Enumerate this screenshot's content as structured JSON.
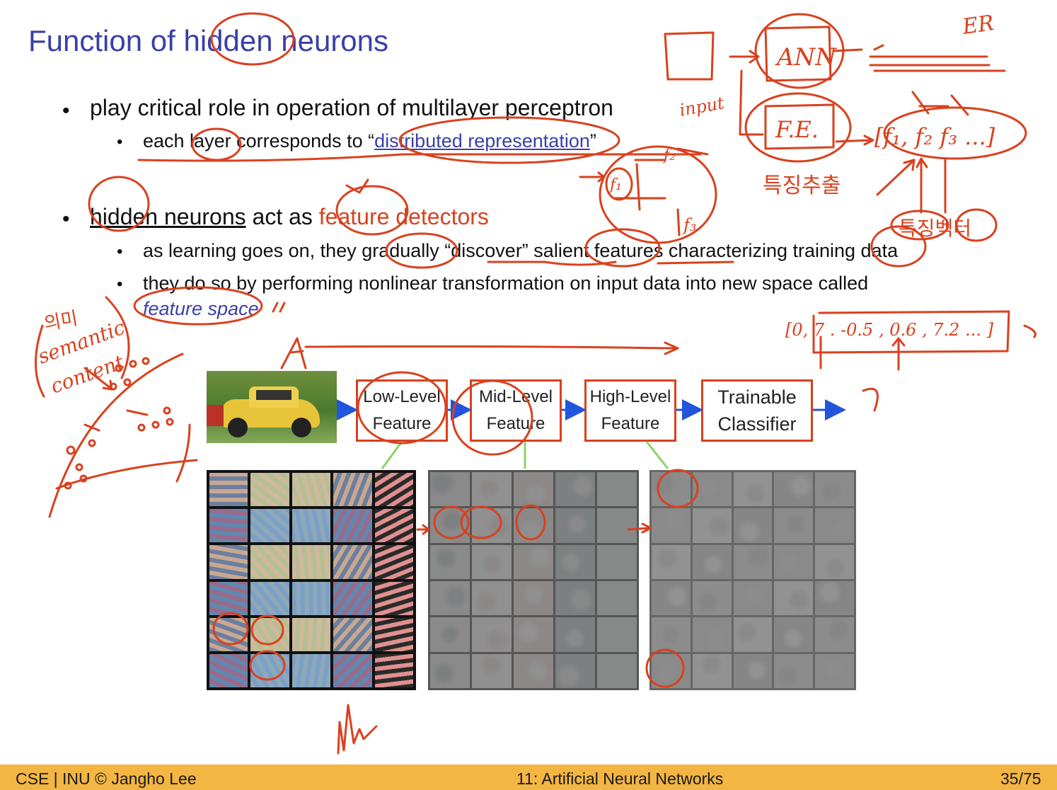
{
  "slide": {
    "title": "Function of hidden neurons",
    "bullet1": "play critical role in operation of multilayer perceptron",
    "bullet1_sub": {
      "prefix": "each layer corresponds to “",
      "highlight": "distributed representation",
      "suffix": "”"
    },
    "bullet2": {
      "underlined": "hidden neurons",
      "middle": " act as ",
      "highlight": "feature detectors"
    },
    "bullet2_sub1": "as learning goes on, they gradually “discover” salient features characterizing training data",
    "bullet2_sub2_line1": "they do so by performing nonlinear transformation on input data into new space called",
    "bullet2_sub2_line2": "feature space"
  },
  "pipeline": {
    "stages": [
      {
        "line1": "Low-Level",
        "line2": "Feature"
      },
      {
        "line1": "Mid-Level",
        "line2": "Feature"
      },
      {
        "line1": "High-Level",
        "line2": "Feature"
      },
      {
        "line1": "Trainable",
        "line2": "Classifier"
      }
    ]
  },
  "annotations": {
    "ann": "ANN",
    "fe": "F.E.",
    "input": "input",
    "er": "ER",
    "features": "[f₁, f₂ f₃ ...]",
    "korean1": "특징추출",
    "korean2": "특징벡터",
    "f1": "f₁",
    "f2": "f₂",
    "f3": "f₃",
    "vector": "[0, 7 . -0.5 , 0.6 , 7.2 ... ]",
    "semantic1": "의미",
    "semantic2": "semantic",
    "semantic3": "content"
  },
  "footer": {
    "left": "CSE | INU © Jangho Lee",
    "center": "11: Artificial Neural Networks",
    "right": "35/75"
  },
  "colors": {
    "title": "#3b3fa8",
    "ink": "#d9411e",
    "footer_bg": "#f3b642",
    "arrow_blue": "#2255dd",
    "arrow_green": "#8fd16a"
  }
}
